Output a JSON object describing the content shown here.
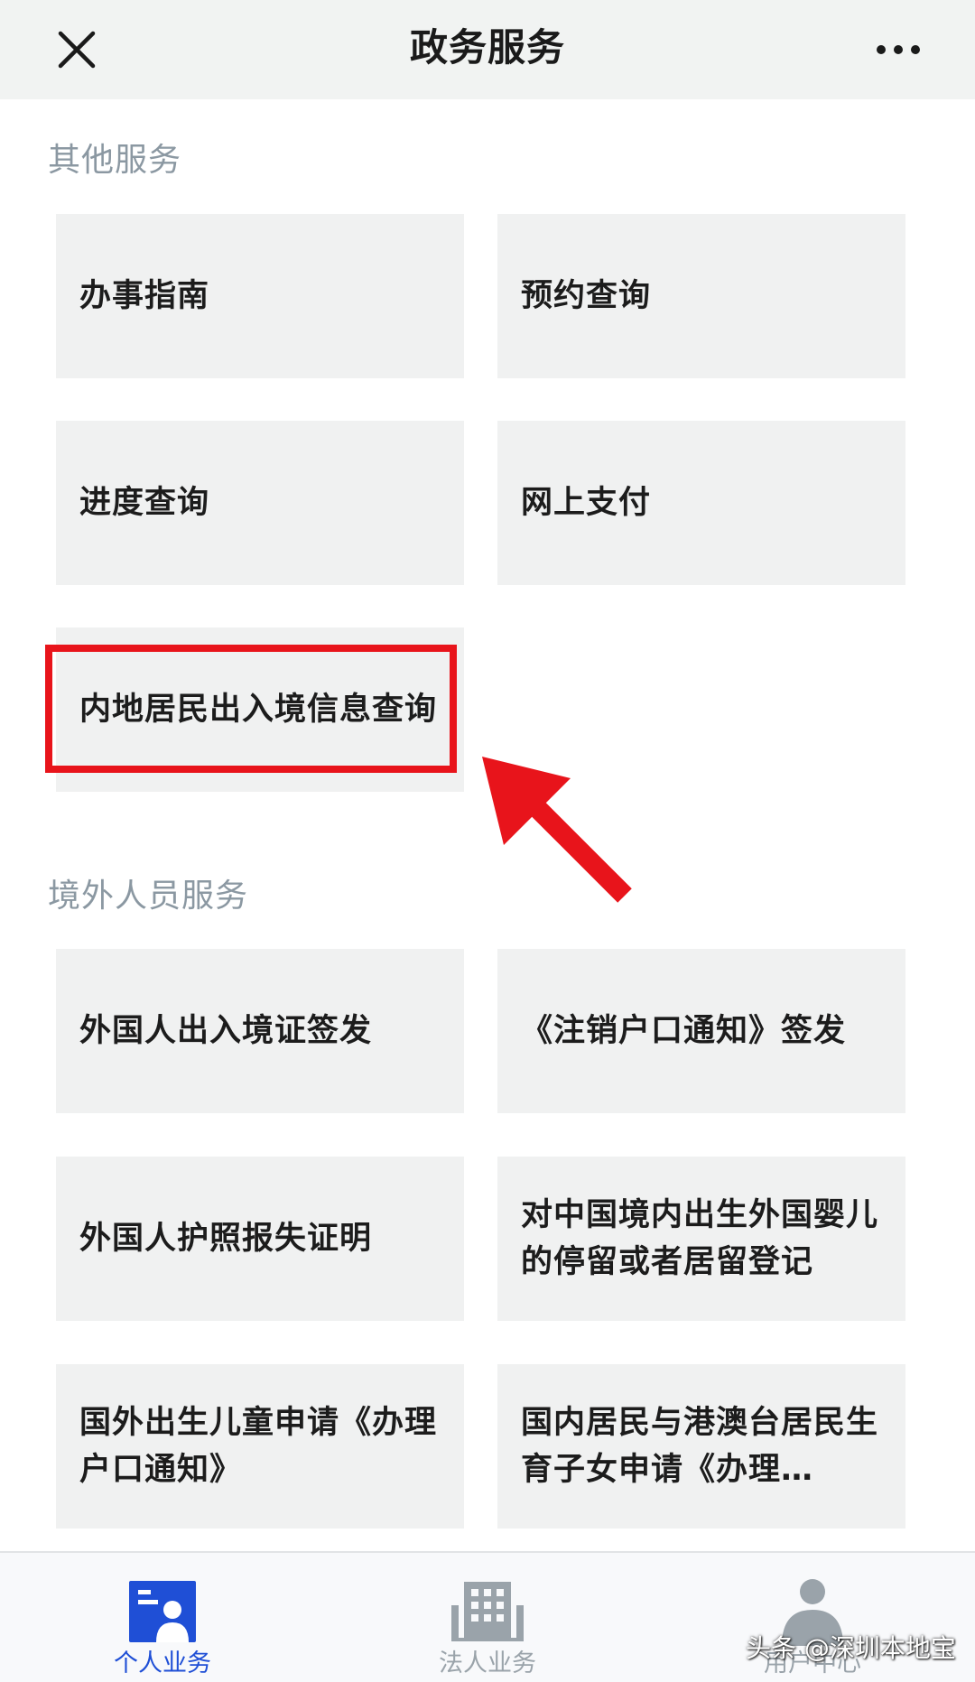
{
  "header": {
    "title": "政务服务"
  },
  "sections": [
    {
      "title": "其他服务",
      "tiles": [
        {
          "label": "办事指南"
        },
        {
          "label": "预约查询"
        },
        {
          "label": "进度查询"
        },
        {
          "label": "网上支付"
        },
        {
          "label": "内地居民出入境信息查询"
        }
      ]
    },
    {
      "title": "境外人员服务",
      "tiles": [
        {
          "label": "外国人出入境证签发"
        },
        {
          "label": "《注销户口通知》签发"
        },
        {
          "label": "外国人护照报失证明"
        },
        {
          "label": "对中国境内出生外国婴儿的停留或者居留登记"
        },
        {
          "label": "国外出生儿童申请《办理户口通知》"
        },
        {
          "label": "国内居民与港澳台居民生育子女申请《办理…"
        }
      ]
    }
  ],
  "bottom_nav": {
    "items": [
      {
        "label": "个人业务",
        "icon": "person-card-icon",
        "active": true
      },
      {
        "label": "法人业务",
        "icon": "building-icon",
        "active": false
      },
      {
        "label": "用户中心",
        "icon": "user-icon",
        "active": false
      }
    ]
  },
  "watermark": "头条 @深圳本地宝",
  "colors": {
    "header_bg": "#f1f3f2",
    "tile_bg": "#f0f1f1",
    "section_title": "#8b98a2",
    "highlight": "#e8141b",
    "nav_active": "#1f4fd6",
    "nav_inactive": "#9aa3aa"
  }
}
